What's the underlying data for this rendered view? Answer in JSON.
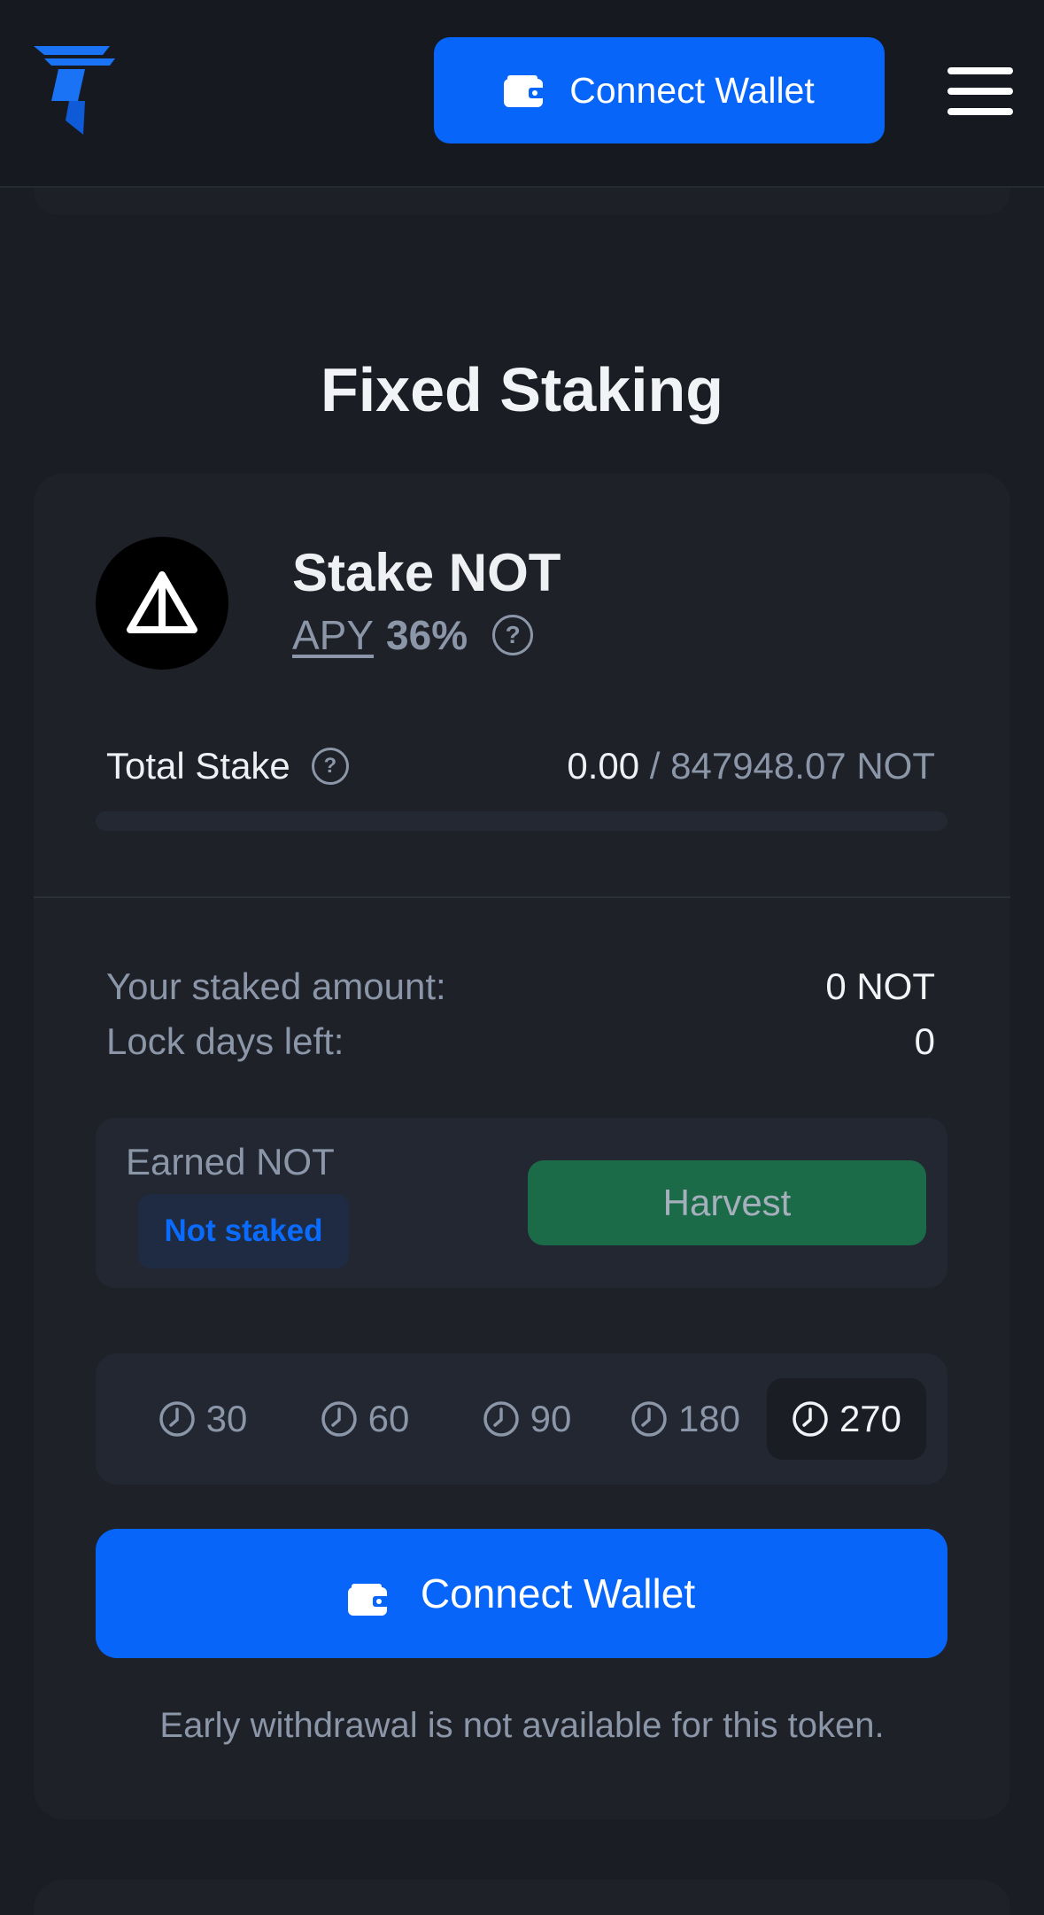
{
  "header": {
    "connect_label": "Connect Wallet",
    "logo_icon": "brand-t-logo",
    "menu_icon": "hamburger-menu-icon"
  },
  "page": {
    "title": "Fixed Staking"
  },
  "card": {
    "stake_title": "Stake NOT",
    "token_icon": "notcoin-triangle-icon",
    "apy_label": "APY",
    "apy_value": "36%",
    "total_stake_label": "Total Stake",
    "total_stake_current": "0.00",
    "total_stake_separator": "/",
    "total_stake_max": "847948.07 NOT",
    "total_stake_progress": 0,
    "staked_amount_label": "Your staked amount:",
    "staked_amount_value": "0 NOT",
    "lock_days_label": "Lock days left:",
    "lock_days_value": "0",
    "earned_label": "Earned NOT",
    "status_badge": "Not staked",
    "harvest_label": "Harvest",
    "lock_periods": [
      "30",
      "60",
      "90",
      "180",
      "270"
    ],
    "selected_period": "270",
    "connect_label": "Connect Wallet",
    "note": "Early withdrawal is not available for this token."
  },
  "colors": {
    "accent": "#0765fa",
    "background": "#1a1d23",
    "card": "#1e2128",
    "harvest": "#1c6b48",
    "muted_text": "#8b96a8"
  }
}
